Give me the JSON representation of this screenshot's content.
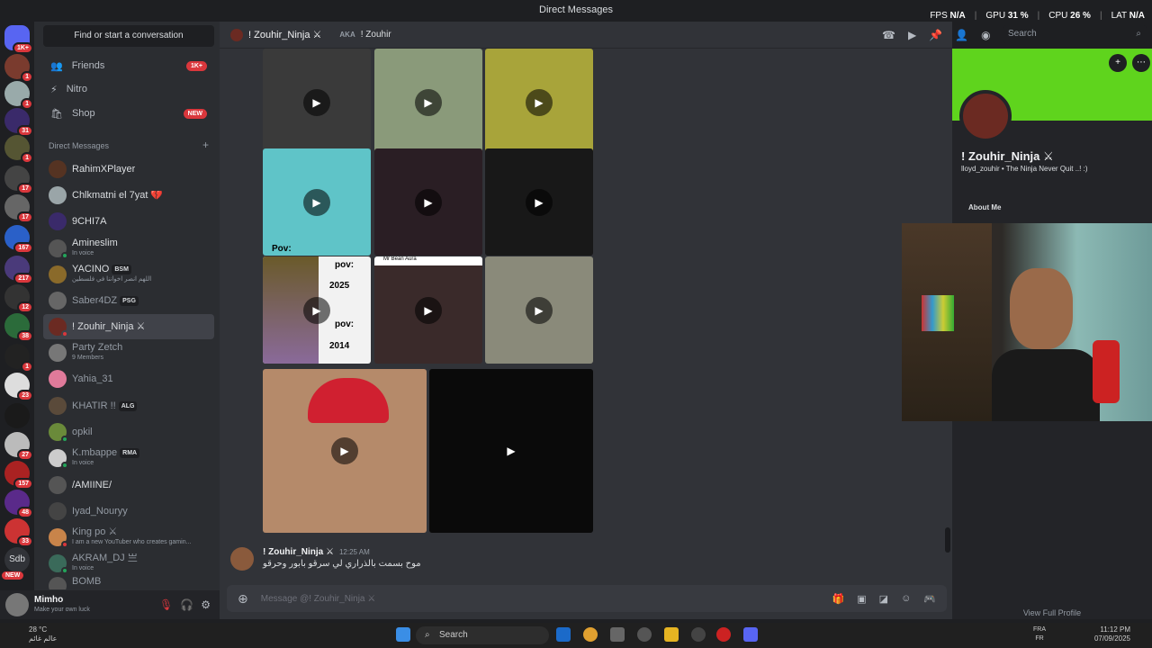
{
  "window": {
    "title": "Direct Messages"
  },
  "overlay": {
    "fps_label": "FPS",
    "fps": "N/A",
    "gpu_label": "GPU",
    "gpu": "31 %",
    "cpu_label": "CPU",
    "cpu": "26 %",
    "lat_label": "LAT",
    "lat": "N/A"
  },
  "guild_badges": [
    "1K+",
    "1",
    "1",
    "31",
    "1",
    "17",
    "167",
    "217",
    "12",
    "38",
    "1",
    "23",
    "27",
    "157",
    "48",
    "33"
  ],
  "guild_labels": {
    "sdb": "Sdb",
    "new": "NEW"
  },
  "sidebar": {
    "finder": "Find or start a conversation",
    "nav": [
      {
        "label": "Friends",
        "badge": "1K+"
      },
      {
        "label": "Nitro",
        "badge": ""
      },
      {
        "label": "Shop",
        "badge": "NEW"
      }
    ],
    "dm_header": "Direct Messages",
    "dms": [
      {
        "name": "RahimXPlayer",
        "sub": "",
        "tag": ""
      },
      {
        "name": "Chlkmatni el 7yat 💔",
        "sub": "",
        "tag": ""
      },
      {
        "name": "9CHI7A",
        "sub": "",
        "tag": ""
      },
      {
        "name": "Amineslim",
        "sub": "In voice",
        "tag": ""
      },
      {
        "name": "YACINO",
        "sub": "اللهم انصر اخواننا في فلسطين",
        "tag": "BSM"
      },
      {
        "name": "Saber4DZ",
        "sub": "",
        "tag": "PSG"
      },
      {
        "name": "! Zouhir_Ninja ⚔",
        "sub": "",
        "tag": ""
      },
      {
        "name": "Party Zetch",
        "sub": "9 Members",
        "tag": ""
      },
      {
        "name": "Yahia_31",
        "sub": "",
        "tag": ""
      },
      {
        "name": "KHATIR !!",
        "sub": "",
        "tag": "ALG"
      },
      {
        "name": "opkil",
        "sub": "",
        "tag": ""
      },
      {
        "name": "K.mbappe",
        "sub": "In voice",
        "tag": "RMA"
      },
      {
        "name": "/AMIINE/",
        "sub": "",
        "tag": ""
      },
      {
        "name": "Iyad_Nouryy",
        "sub": "",
        "tag": ""
      },
      {
        "name": "King po ⚔",
        "sub": "I am a new YouTuber who creates gamin...",
        "tag": ""
      },
      {
        "name": "AKRAM_DJ 亗",
        "sub": "In voice",
        "tag": ""
      },
      {
        "name": "BOMB",
        "sub": "",
        "tag": ""
      }
    ]
  },
  "user": {
    "name": "Mimho",
    "status": "Make your own luck"
  },
  "chat": {
    "recipient": "! Zouhir_Ninja ⚔",
    "aka_label": "AKA",
    "aka": "! Zouhir",
    "search_placeholder": "Search",
    "media_labels": {
      "pov": "pov:",
      "year1": "2025",
      "year2": "2014",
      "mrbean": "Mr Bean Aura",
      "pov2": "Pov:"
    },
    "message": {
      "author": "! Zouhir_Ninja ⚔",
      "time": "12:25 AM",
      "text": "موح بسمت بالذراري لي سرقو بابور وحرقو"
    },
    "composer_placeholder": "Message @! Zouhir_Ninja ⚔"
  },
  "profile": {
    "name": "! Zouhir_Ninja ⚔",
    "description": "lloyd_zouhir • The Ninja Never Quit ..! :)",
    "about_label": "About Me",
    "view_full": "View Full Profile",
    "banner_color": "#5fd41d"
  },
  "taskbar": {
    "temp": "28 °C",
    "weather_text": "عالم غائم",
    "search": "Search",
    "lang1": "FRA",
    "lang2": "FR",
    "time": "11:12 PM",
    "date": "07/09/2025"
  }
}
